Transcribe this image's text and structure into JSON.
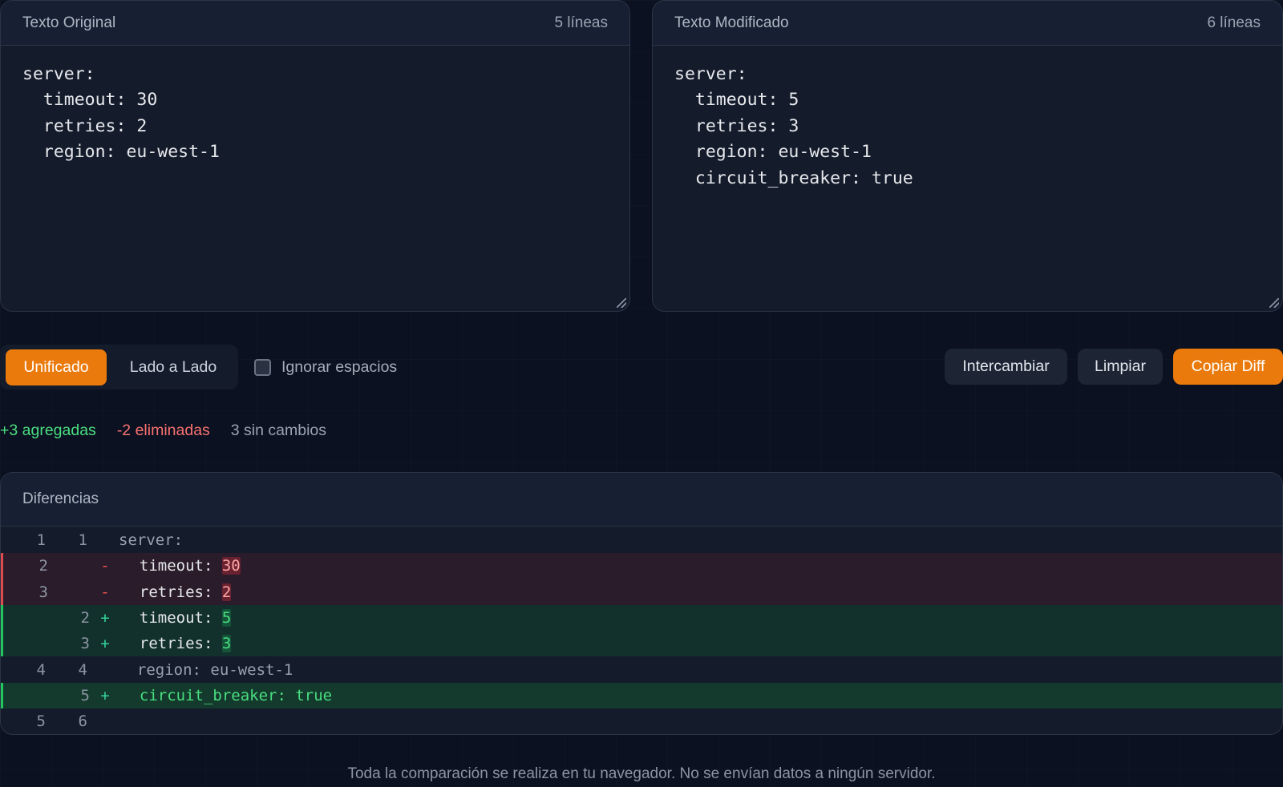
{
  "editors": {
    "original": {
      "title": "Texto Original",
      "line_count": "5 líneas",
      "content": "server:\n  timeout: 30\n  retries: 2\n  region: eu-west-1"
    },
    "modified": {
      "title": "Texto Modificado",
      "line_count": "6 líneas",
      "content": "server:\n  timeout: 5\n  retries: 3\n  region: eu-west-1\n  circuit_breaker: true"
    }
  },
  "toolbar": {
    "mode_unified": "Unificado",
    "mode_side_by_side": "Lado a Lado",
    "active_mode": "Unificado",
    "ignore_whitespace_label": "Ignorar espacios",
    "ignore_whitespace_checked": false,
    "swap_label": "Intercambiar",
    "clear_label": "Limpiar",
    "copy_label": "Copiar Diff"
  },
  "stats": {
    "added": "+3 agregadas",
    "removed": "-2 eliminadas",
    "unchanged": "3 sin cambios"
  },
  "diff": {
    "title": "Diferencias",
    "rows": [
      {
        "type": "ctx",
        "old": "1",
        "new": "1",
        "marker": "",
        "prefix": "server:",
        "highlight": "",
        "suffix": ""
      },
      {
        "type": "del",
        "old": "2",
        "new": "",
        "marker": "-",
        "prefix": "  timeout: ",
        "highlight": "30",
        "suffix": ""
      },
      {
        "type": "del",
        "old": "3",
        "new": "",
        "marker": "-",
        "prefix": "  retries: ",
        "highlight": "2",
        "suffix": ""
      },
      {
        "type": "add",
        "old": "",
        "new": "2",
        "marker": "+",
        "prefix": "  timeout: ",
        "highlight": "5",
        "suffix": ""
      },
      {
        "type": "add",
        "old": "",
        "new": "3",
        "marker": "+",
        "prefix": "  retries: ",
        "highlight": "3",
        "suffix": ""
      },
      {
        "type": "ctx",
        "old": "4",
        "new": "4",
        "marker": "",
        "prefix": "  region: eu-west-1",
        "highlight": "",
        "suffix": ""
      },
      {
        "type": "add-strong",
        "old": "",
        "new": "5",
        "marker": "+",
        "prefix": "  circuit_breaker: true",
        "highlight": "",
        "suffix": ""
      },
      {
        "type": "ctx",
        "old": "5",
        "new": "6",
        "marker": "",
        "prefix": "",
        "highlight": "",
        "suffix": ""
      }
    ]
  },
  "footer": {
    "note": "Toda la comparación se realiza en tu navegador. No se envían datos a ningún servidor."
  },
  "colors": {
    "accent": "#ea7a0c",
    "added": "#4ade80",
    "removed": "#f87171",
    "background": "#0b1120",
    "panel": "#141b2b"
  }
}
